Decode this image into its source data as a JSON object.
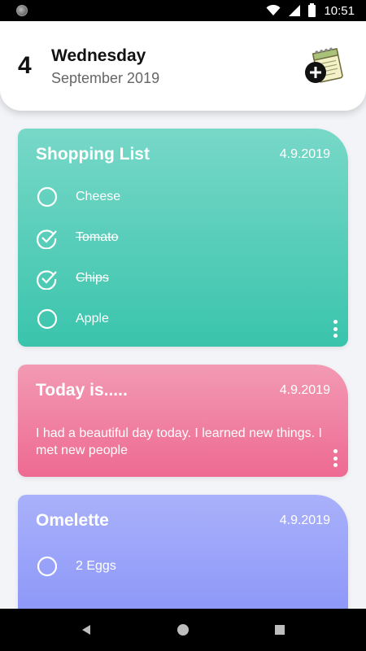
{
  "status_bar": {
    "time": "10:51"
  },
  "header": {
    "day_number": "4",
    "day_name": "Wednesday",
    "month_year": "September 2019"
  },
  "cards": [
    {
      "title": "Shopping List",
      "date": "4.9.2019",
      "color": "#3ac4ac",
      "items": [
        {
          "label": "Cheese",
          "checked": false
        },
        {
          "label": "Tomato",
          "checked": true
        },
        {
          "label": "Chips",
          "checked": true
        },
        {
          "label": "Apple",
          "checked": false
        }
      ]
    },
    {
      "title": "Today is.....",
      "date": "4.9.2019",
      "color": "#ee6a92",
      "body": "I had a beautiful day today. I learned new things. I met new people"
    },
    {
      "title": "Omelette",
      "date": "4.9.2019",
      "color": "#8a95f7",
      "items": [
        {
          "label": "2 Eggs",
          "checked": false
        }
      ]
    }
  ],
  "icons": {
    "add_note": "notepad-plus-icon",
    "more": "more-vertical-icon",
    "unchecked": "circle-icon",
    "checked": "check-circle-icon"
  }
}
